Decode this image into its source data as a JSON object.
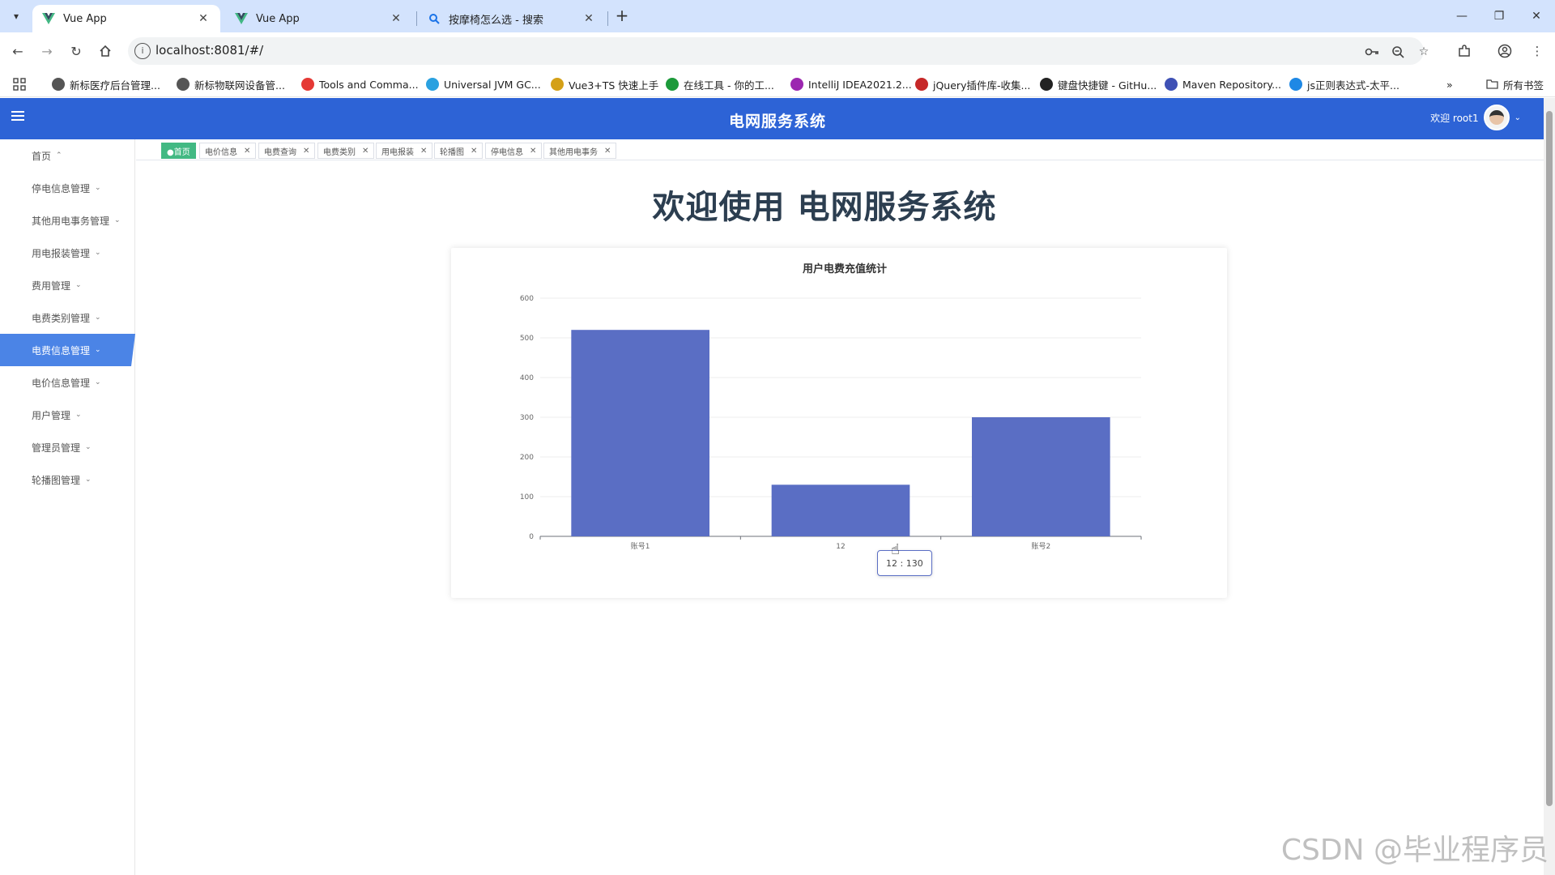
{
  "browser": {
    "tabs": [
      {
        "title": "Vue App",
        "active": true
      },
      {
        "title": "Vue App",
        "active": false
      },
      {
        "title": "按摩椅怎么选 - 搜索",
        "active": false
      }
    ],
    "url": "localhost:8081/#/",
    "bookmarks": [
      {
        "label": "新标医疗后台管理...",
        "color": "#555555",
        "icon": "globe-icon"
      },
      {
        "label": "新标物联网设备管...",
        "color": "#555555",
        "icon": "globe-icon"
      },
      {
        "label": "Tools and Comma...",
        "color": "#e53935",
        "icon": "oval-icon"
      },
      {
        "label": "Universal JVM GC...",
        "color": "#2aa1e0",
        "icon": "gc-icon"
      },
      {
        "label": "Vue3+TS 快速上手",
        "color": "#d4a017",
        "icon": "power-icon"
      },
      {
        "label": "在线工具 - 你的工...",
        "color": "#1c9a3a",
        "icon": "t-icon"
      },
      {
        "label": "IntelliJ IDEA2021.2...",
        "color": "#9c27b0",
        "icon": "intellij-icon"
      },
      {
        "label": "jQuery插件库-收集...",
        "color": "#c62828",
        "icon": "jquery-icon"
      },
      {
        "label": "键盘快捷键 - GitHu...",
        "color": "#222222",
        "icon": "github-icon"
      },
      {
        "label": "Maven Repository...",
        "color": "#3f51b5",
        "icon": "maven-icon"
      },
      {
        "label": "js正则表达式-太平...",
        "color": "#1e88e5",
        "icon": "c-icon"
      }
    ],
    "all_bookmarks": "所有书签"
  },
  "app": {
    "title": "电网服务系统",
    "welcome_user": "欢迎 root1",
    "welcome_heading": "欢迎使用 电网服务系统",
    "brand_color": "#2d63d6"
  },
  "sidebar": {
    "items": [
      {
        "label": "首页",
        "caret": "⌃",
        "active": false
      },
      {
        "label": "停电信息管理",
        "caret": "⌄",
        "active": false
      },
      {
        "label": "其他用电事务管理",
        "caret": "⌄",
        "active": false
      },
      {
        "label": "用电报装管理",
        "caret": "⌄",
        "active": false
      },
      {
        "label": "费用管理",
        "caret": "⌄",
        "active": false
      },
      {
        "label": "电费类别管理",
        "caret": "⌄",
        "active": false
      },
      {
        "label": "电费信息管理",
        "caret": "⌄",
        "active": true
      },
      {
        "label": "电价信息管理",
        "caret": "⌄",
        "active": false
      },
      {
        "label": "用户管理",
        "caret": "⌄",
        "active": false
      },
      {
        "label": "管理员管理",
        "caret": "⌄",
        "active": false
      },
      {
        "label": "轮播图管理",
        "caret": "⌄",
        "active": false
      }
    ]
  },
  "tags": [
    {
      "label": "●首页",
      "active": true,
      "closable": false
    },
    {
      "label": "电价信息",
      "active": false,
      "closable": true
    },
    {
      "label": "电费查询",
      "active": false,
      "closable": true
    },
    {
      "label": "电费类别",
      "active": false,
      "closable": true
    },
    {
      "label": "用电报装",
      "active": false,
      "closable": true
    },
    {
      "label": "轮播图",
      "active": false,
      "closable": true
    },
    {
      "label": "停电信息",
      "active": false,
      "closable": true
    },
    {
      "label": "其他用电事务",
      "active": false,
      "closable": true
    }
  ],
  "chart_data": {
    "type": "bar",
    "title": "用户电费充值统计",
    "categories": [
      "账号1",
      "12",
      "账号2"
    ],
    "values": [
      520,
      130,
      300
    ],
    "ylim": [
      0,
      600
    ],
    "yticks": [
      0,
      100,
      200,
      300,
      400,
      500,
      600
    ],
    "grid": true,
    "bar_color": "#5a6ec4",
    "tooltip": "12 : 130"
  },
  "watermark": "CSDN @毕业程序员"
}
